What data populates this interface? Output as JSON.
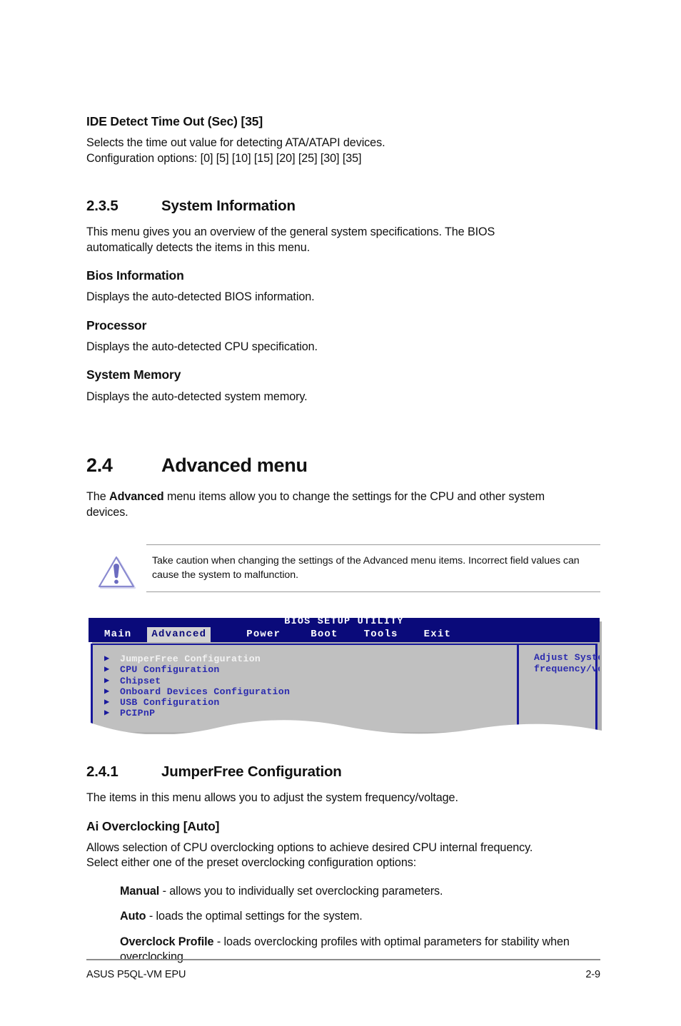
{
  "document": {
    "section_ide": {
      "heading": "IDE Detect Time Out (Sec) [35]",
      "line1": "Selects the time out value for detecting ATA/ATAPI devices.",
      "line2": "Configuration options: [0] [5] [10] [15] [20] [25] [30] [35]"
    },
    "section_235": {
      "number": "2.3.5",
      "title": "System Information",
      "intro": "This menu gives you an overview of the general system specifications. The BIOS automatically detects the items in this menu.",
      "sub1_heading": "Bios Information",
      "sub1_text": "Displays the auto-detected BIOS information.",
      "sub2_heading": "Processor",
      "sub2_text": "Displays the auto-detected CPU specification.",
      "sub3_heading": "System Memory",
      "sub3_text": "Displays the auto-detected system memory."
    },
    "section_24": {
      "number": "2.4",
      "title": "Advanced menu",
      "intro_pre": "The ",
      "intro_bold": "Advanced",
      "intro_post": " menu items allow you to change the settings for the CPU and other system devices."
    },
    "caution": {
      "icon": "warning-triangle-icon",
      "text": "Take caution when changing the settings of the Advanced menu items. Incorrect field values can cause the system to malfunction."
    },
    "section_241": {
      "number": "2.4.1",
      "title": "JumperFree Configuration",
      "intro": "The items in this menu allows you to adjust the system frequency/voltage.",
      "sub_heading": "Ai Overclocking [Auto]",
      "sub_line1": "Allows selection of CPU overclocking options to achieve desired CPU internal frequency.",
      "sub_line2": "Select either one of the preset overclocking configuration options:",
      "bullets": [
        {
          "term": "Manual",
          "desc": " - allows you to individually set overclocking parameters."
        },
        {
          "term": "Auto",
          "desc": " - loads the optimal settings for the system."
        },
        {
          "term": "Overclock Profile",
          "desc": " - loads overclocking profiles with optimal parameters for stability when overclocking."
        }
      ]
    }
  },
  "bios_screenshot": {
    "title": "BIOS SETUP UTILITY",
    "tabs": [
      {
        "label": "Main",
        "active": false
      },
      {
        "label": "Advanced",
        "active": true
      },
      {
        "label": "Power",
        "active": false
      },
      {
        "label": "Boot",
        "active": false
      },
      {
        "label": "Tools",
        "active": false
      },
      {
        "label": "Exit",
        "active": false
      }
    ],
    "menu_items": [
      {
        "label": "JumperFree Configuration",
        "selected": true
      },
      {
        "label": "CPU Configuration",
        "selected": false
      },
      {
        "label": "Chipset",
        "selected": false
      },
      {
        "label": "Onboard Devices Configuration",
        "selected": false
      },
      {
        "label": "USB Configuration",
        "selected": false
      },
      {
        "label": "PCIPnP",
        "selected": false
      }
    ],
    "help_text": "Adjust System\nfrequency/voltage.",
    "arrow_glyph": "▶",
    "colors": {
      "header_bg": "#0a0a7a",
      "body_bg": "#c0c0c0",
      "border": "#18189c",
      "text_blue": "#2b2bae",
      "active_tab_bg": "#d2d2d2"
    }
  },
  "footer": {
    "left": "ASUS P5QL-VM EPU",
    "right": "2-9"
  }
}
